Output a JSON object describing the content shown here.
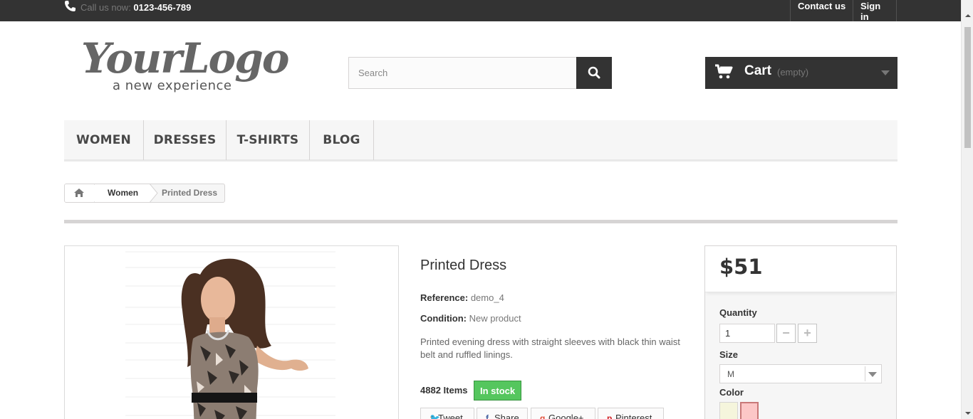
{
  "topbar": {
    "call_prefix": "Call us now: ",
    "phone": "0123-456-789",
    "contact_label": "Contact us",
    "signin_label": "Sign in"
  },
  "header": {
    "logo_main": "YourLogo",
    "logo_sub": "a new experience",
    "search_placeholder": "Search",
    "cart_label": "Cart",
    "cart_status": "(empty)"
  },
  "menu": {
    "items": [
      {
        "label": "WOMEN"
      },
      {
        "label": "DRESSES"
      },
      {
        "label": "T-SHIRTS"
      },
      {
        "label": "BLOG"
      }
    ]
  },
  "breadcrumb": {
    "parent": "Women",
    "current": "Printed Dress"
  },
  "product": {
    "title": "Printed Dress",
    "reference_label": "Reference:",
    "reference_value": "demo_4",
    "condition_label": "Condition:",
    "condition_value": "New product",
    "description": "Printed evening dress with straight sleeves with black thin waist belt and ruffled linings.",
    "items_count": "4882 Items",
    "stock_status": "In stock",
    "share": {
      "tweet": "Tweet",
      "share": "Share",
      "google": "Google+",
      "pinterest": "Pinterest"
    }
  },
  "buybox": {
    "price": "$51",
    "quantity_label": "Quantity",
    "quantity_value": "1",
    "size_label": "Size",
    "size_value": "M",
    "color_label": "Color",
    "colors": [
      "#f5f5dc",
      "#fcc7c7"
    ]
  },
  "colors": {
    "topbar": "#333333",
    "in_stock": "#55c65e",
    "menu_bg": "#f6f6f6"
  }
}
